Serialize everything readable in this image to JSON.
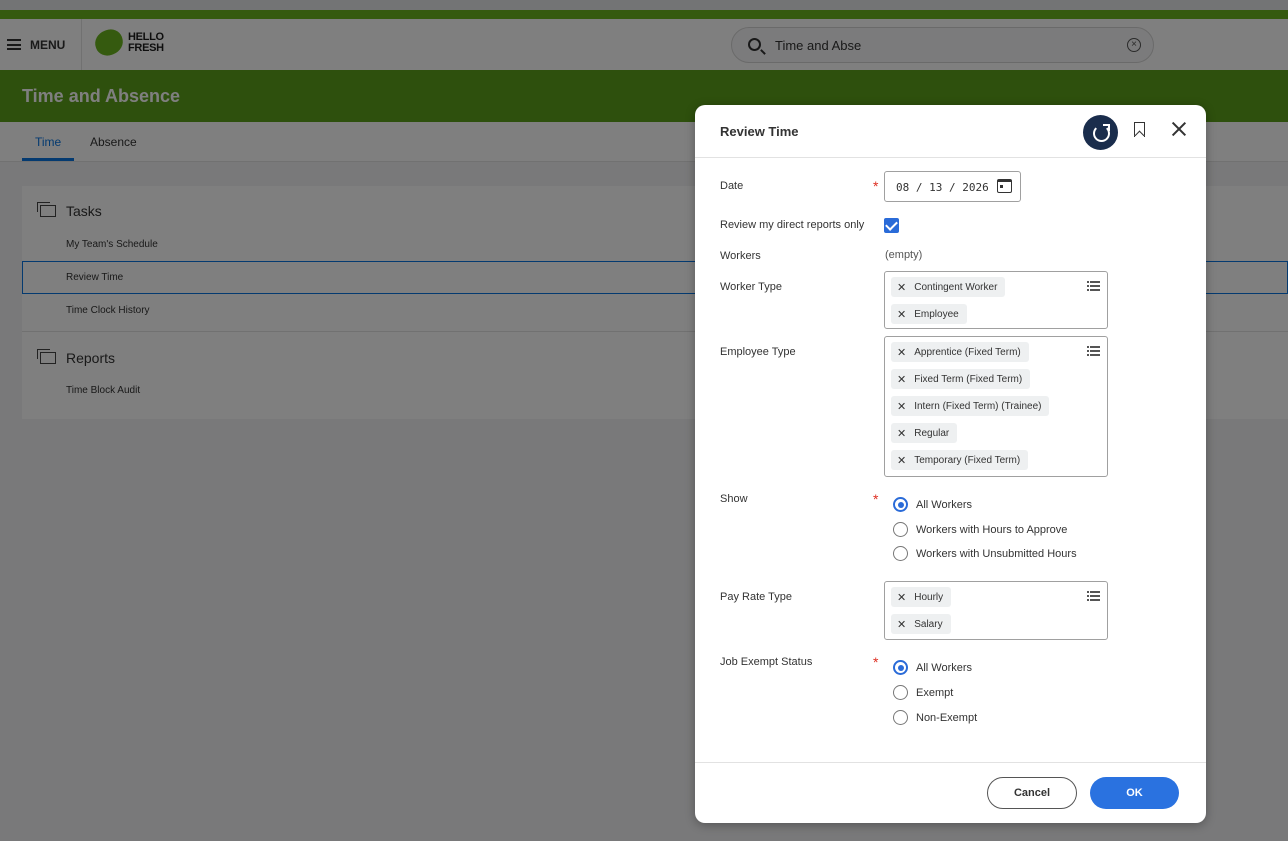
{
  "header": {
    "menu_label": "MENU",
    "logo_line1": "HELLO",
    "logo_line2": "FRESH",
    "search_value": "Time and Abse"
  },
  "banner": {
    "title": "Time and Absence"
  },
  "tabs": [
    {
      "label": "Time",
      "active": true
    },
    {
      "label": "Absence",
      "active": false
    }
  ],
  "tasks_section": {
    "title": "Tasks",
    "items": [
      "My Team's Schedule",
      "Review Time",
      "Time Clock History"
    ],
    "selected": "Review Time"
  },
  "reports_section": {
    "title": "Reports",
    "items": [
      "Time Block Audit"
    ]
  },
  "dialog": {
    "title": "Review Time",
    "date": {
      "label": "Date",
      "value": "08 / 13 / 2026",
      "required": true
    },
    "direct_reports": {
      "label": "Review my direct reports only",
      "checked": true
    },
    "workers": {
      "label": "Workers",
      "value": "(empty)"
    },
    "worker_type": {
      "label": "Worker Type",
      "values": [
        "Contingent Worker",
        "Employee"
      ]
    },
    "employee_type": {
      "label": "Employee Type",
      "values": [
        "Apprentice (Fixed Term)",
        "Fixed Term (Fixed Term)",
        "Intern (Fixed Term) (Trainee)",
        "Regular",
        "Temporary (Fixed Term)"
      ]
    },
    "show": {
      "label": "Show",
      "required": true,
      "options": [
        "All Workers",
        "Workers with Hours to Approve",
        "Workers with Unsubmitted Hours"
      ],
      "selected": "All Workers"
    },
    "pay_rate_type": {
      "label": "Pay Rate Type",
      "values": [
        "Hourly",
        "Salary"
      ]
    },
    "job_exempt_status": {
      "label": "Job Exempt Status",
      "required": true,
      "options": [
        "All Workers",
        "Exempt",
        "Non-Exempt"
      ],
      "selected": "All Workers"
    },
    "cancel_label": "Cancel",
    "ok_label": "OK",
    "required_mark": "*"
  },
  "colors": {
    "brand_green": "#5ca01a",
    "accent_blue": "#0875e1",
    "ok_button": "#2a72e0",
    "required_red": "#de2e21"
  }
}
